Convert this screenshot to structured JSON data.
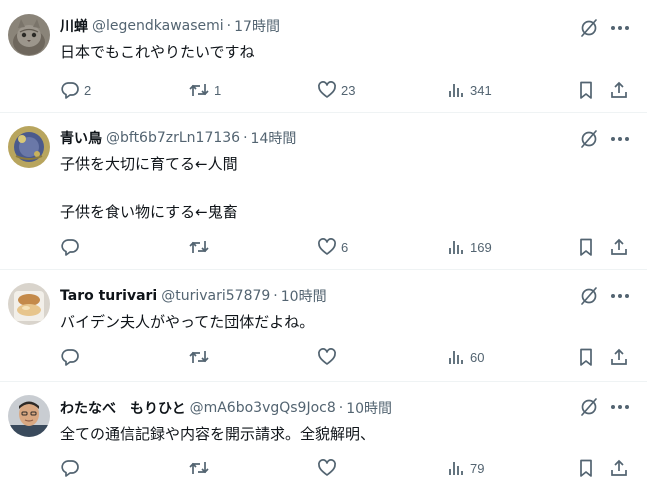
{
  "icons": {
    "reply": "reply-icon",
    "retweet": "retweet-icon",
    "like": "like-icon",
    "views": "views-icon",
    "bookmark": "bookmark-icon",
    "share": "share-icon",
    "grok": "grok-icon",
    "more": "more-icon"
  },
  "colors": {
    "text": "#0f1419",
    "secondary": "#536471",
    "divider": "#eff3f4"
  },
  "tweets": [
    {
      "name": "川蝉",
      "handle": "@legendkawasemi",
      "separator": "·",
      "time": "17時間",
      "lines": [
        "日本でもこれやりたいですね"
      ],
      "replies": "2",
      "retweets": "1",
      "likes": "23",
      "views": "341"
    },
    {
      "name": "青い鳥",
      "handle": "@bft6b7zrLn17136",
      "separator": "·",
      "time": "14時間",
      "lines": [
        "子供を大切に育てる←人間",
        "子供を食い物にする←鬼畜"
      ],
      "replies": "",
      "retweets": "",
      "likes": "6",
      "views": "169"
    },
    {
      "name": "Taro turivari",
      "handle": "@turivari57879",
      "separator": "·",
      "time": "10時間",
      "lines": [
        "バイデン夫人がやってた団体だよね。"
      ],
      "replies": "",
      "retweets": "",
      "likes": "",
      "views": "60"
    },
    {
      "name": "わたなべ　もりひと",
      "handle": "@mA6bo3vgQs9Joc8",
      "separator": "·",
      "time": "10時間",
      "lines": [
        "全ての通信記録や内容を開示請求。全貌解明、"
      ],
      "replies": "",
      "retweets": "",
      "likes": "",
      "views": "79"
    }
  ]
}
